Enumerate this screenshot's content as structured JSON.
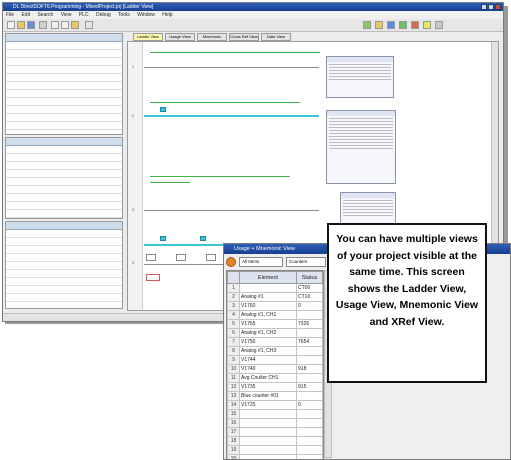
{
  "main_window": {
    "title": "DL DirectSOFT6 Programming - MixedProject.prj [Ladder View]",
    "menu": [
      "File",
      "Edit",
      "Search",
      "View",
      "PLC",
      "Debug",
      "Tools",
      "Window",
      "Help"
    ],
    "tabs": [
      "Ladder View",
      "Usage View",
      "Mnemonic View",
      "Cross Ref View",
      "Data View"
    ],
    "rung_numbers": [
      "1",
      "2",
      "3",
      "4"
    ],
    "colors": {
      "title_bar": "#1f4fa6",
      "contact": "#39c6d6",
      "rung_comment": "#3bb34a"
    }
  },
  "xref_window": {
    "title": "Usage + Mnemonic View",
    "toolbar_options": [
      "All Items",
      "Counters"
    ],
    "columns": [
      "Element",
      "Status"
    ],
    "rows": [
      {
        "element": "",
        "status": "CT00"
      },
      {
        "element": "Analog #1",
        "status": "CT10"
      },
      {
        "element": "V1760",
        "status": "0"
      },
      {
        "element": "Analog #1, CH1",
        "status": ""
      },
      {
        "element": "V1755",
        "status": "7326"
      },
      {
        "element": "Analog #1, CH2",
        "status": ""
      },
      {
        "element": "V1750",
        "status": "7654"
      },
      {
        "element": "Analog #1, CH3",
        "status": ""
      },
      {
        "element": "V1744",
        "status": ""
      },
      {
        "element": "V1740",
        "status": "918"
      },
      {
        "element": "Avg Coulter CH1",
        "status": ""
      },
      {
        "element": "V1735",
        "status": "915"
      },
      {
        "element": "Blue counter #01",
        "status": ""
      },
      {
        "element": "V1725",
        "status": "0"
      },
      {
        "element": "",
        "status": ""
      },
      {
        "element": "",
        "status": ""
      },
      {
        "element": "",
        "status": ""
      },
      {
        "element": "",
        "status": ""
      },
      {
        "element": "",
        "status": ""
      },
      {
        "element": "",
        "status": ""
      }
    ]
  },
  "callout": {
    "text": "You can have multiple views of your project visible at the same time. This screen shows the Ladder View, Usage View, Mnemonic View and XRef View."
  }
}
